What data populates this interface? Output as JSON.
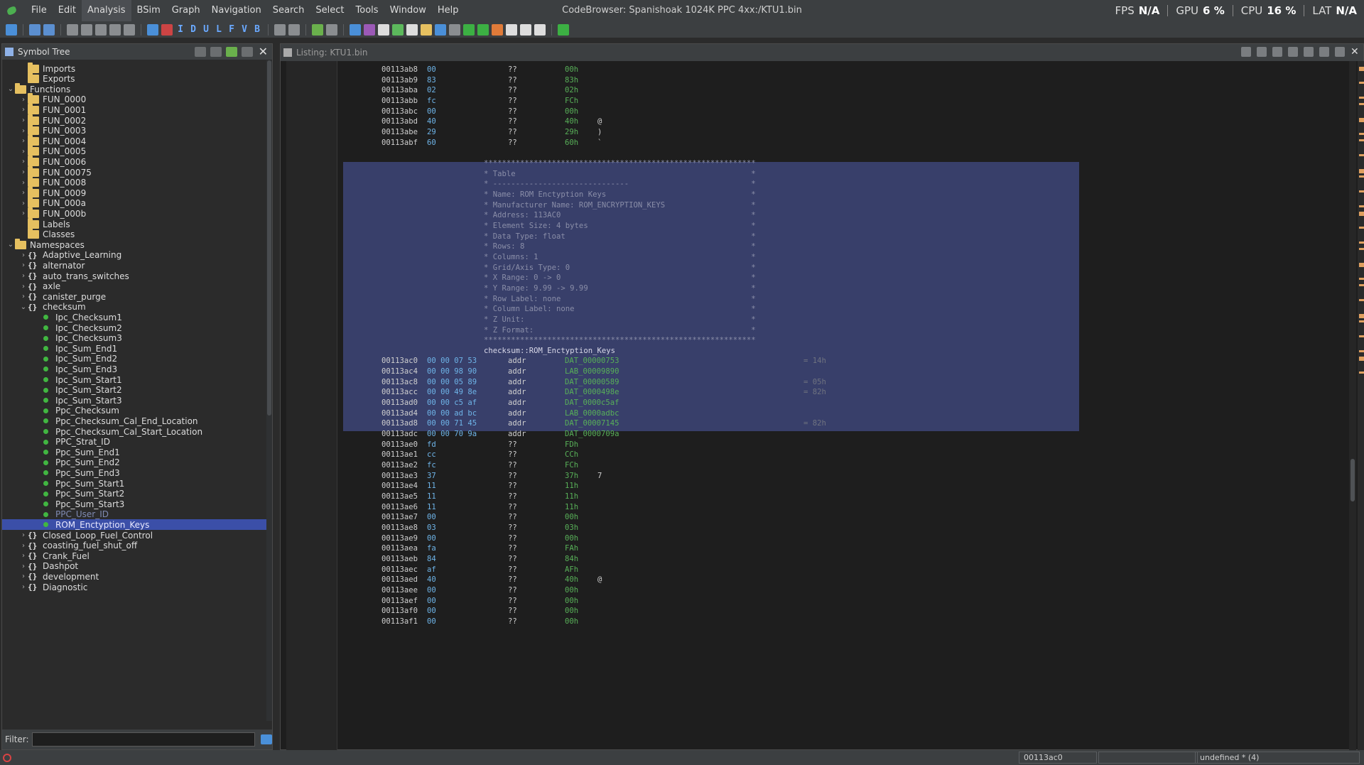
{
  "app": {
    "title": "CodeBrowser: Spanishoak 1024K PPC 4xx:/KTU1.bin",
    "menus": [
      "File",
      "Edit",
      "Analysis",
      "BSim",
      "Graph",
      "Navigation",
      "Search",
      "Select",
      "Tools",
      "Window",
      "Help"
    ],
    "active_menu": "Analysis"
  },
  "perf": {
    "fps_label": "FPS",
    "fps_value": "N/A",
    "gpu_label": "GPU",
    "gpu_value": "6 %",
    "cpu_label": "CPU",
    "cpu_value": "16 %",
    "lat_label": "LAT",
    "lat_value": "N/A"
  },
  "toolbar": {
    "letters": [
      "I",
      "D",
      "U",
      "L",
      "F",
      "V",
      "B"
    ]
  },
  "symbol_tree": {
    "title": "Symbol Tree",
    "filter_label": "Filter:",
    "filter_value": "",
    "rows": [
      {
        "level": 1,
        "kind": "folder",
        "chev": "",
        "label": "Imports"
      },
      {
        "level": 1,
        "kind": "folder",
        "chev": "",
        "label": "Exports"
      },
      {
        "level": 0,
        "kind": "folder",
        "chev": "v",
        "label": "Functions"
      },
      {
        "level": 1,
        "kind": "folder",
        "chev": ">",
        "label": "FUN_0000"
      },
      {
        "level": 1,
        "kind": "folder",
        "chev": ">",
        "label": "FUN_0001"
      },
      {
        "level": 1,
        "kind": "folder",
        "chev": ">",
        "label": "FUN_0002"
      },
      {
        "level": 1,
        "kind": "folder",
        "chev": ">",
        "label": "FUN_0003"
      },
      {
        "level": 1,
        "kind": "folder",
        "chev": ">",
        "label": "FUN_0004"
      },
      {
        "level": 1,
        "kind": "folder",
        "chev": ">",
        "label": "FUN_0005"
      },
      {
        "level": 1,
        "kind": "folder",
        "chev": ">",
        "label": "FUN_0006"
      },
      {
        "level": 1,
        "kind": "folder",
        "chev": ">",
        "label": "FUN_00075"
      },
      {
        "level": 1,
        "kind": "folder",
        "chev": ">",
        "label": "FUN_0008"
      },
      {
        "level": 1,
        "kind": "folder",
        "chev": ">",
        "label": "FUN_0009"
      },
      {
        "level": 1,
        "kind": "folder",
        "chev": ">",
        "label": "FUN_000a"
      },
      {
        "level": 1,
        "kind": "folder",
        "chev": ">",
        "label": "FUN_000b"
      },
      {
        "level": 1,
        "kind": "folder",
        "chev": "",
        "label": "Labels"
      },
      {
        "level": 1,
        "kind": "folder",
        "chev": "",
        "label": "Classes"
      },
      {
        "level": 0,
        "kind": "folder",
        "chev": "v",
        "label": "Namespaces"
      },
      {
        "level": 1,
        "kind": "ns",
        "chev": ">",
        "label": "Adaptive_Learning"
      },
      {
        "level": 1,
        "kind": "ns",
        "chev": ">",
        "label": "alternator"
      },
      {
        "level": 1,
        "kind": "ns",
        "chev": ">",
        "label": "auto_trans_switches"
      },
      {
        "level": 1,
        "kind": "ns",
        "chev": ">",
        "label": "axle"
      },
      {
        "level": 1,
        "kind": "ns",
        "chev": ">",
        "label": "canister_purge"
      },
      {
        "level": 1,
        "kind": "ns",
        "chev": "v",
        "label": "checksum"
      },
      {
        "level": 2,
        "kind": "dot",
        "chev": "",
        "label": "Ipc_Checksum1"
      },
      {
        "level": 2,
        "kind": "dot",
        "chev": "",
        "label": "Ipc_Checksum2"
      },
      {
        "level": 2,
        "kind": "dot",
        "chev": "",
        "label": "Ipc_Checksum3"
      },
      {
        "level": 2,
        "kind": "dot",
        "chev": "",
        "label": "Ipc_Sum_End1"
      },
      {
        "level": 2,
        "kind": "dot",
        "chev": "",
        "label": "Ipc_Sum_End2"
      },
      {
        "level": 2,
        "kind": "dot",
        "chev": "",
        "label": "Ipc_Sum_End3"
      },
      {
        "level": 2,
        "kind": "dot",
        "chev": "",
        "label": "Ipc_Sum_Start1"
      },
      {
        "level": 2,
        "kind": "dot",
        "chev": "",
        "label": "Ipc_Sum_Start2"
      },
      {
        "level": 2,
        "kind": "dot",
        "chev": "",
        "label": "Ipc_Sum_Start3"
      },
      {
        "level": 2,
        "kind": "dot",
        "chev": "",
        "label": "Ppc_Checksum"
      },
      {
        "level": 2,
        "kind": "dot",
        "chev": "",
        "label": "Ppc_Checksum_Cal_End_Location"
      },
      {
        "level": 2,
        "kind": "dot",
        "chev": "",
        "label": "Ppc_Checksum_Cal_Start_Location"
      },
      {
        "level": 2,
        "kind": "dot",
        "chev": "",
        "label": "PPC_Strat_ID"
      },
      {
        "level": 2,
        "kind": "dot",
        "chev": "",
        "label": "Ppc_Sum_End1"
      },
      {
        "level": 2,
        "kind": "dot",
        "chev": "",
        "label": "Ppc_Sum_End2"
      },
      {
        "level": 2,
        "kind": "dot",
        "chev": "",
        "label": "Ppc_Sum_End3"
      },
      {
        "level": 2,
        "kind": "dot",
        "chev": "",
        "label": "Ppc_Sum_Start1"
      },
      {
        "level": 2,
        "kind": "dot",
        "chev": "",
        "label": "Ppc_Sum_Start2"
      },
      {
        "level": 2,
        "kind": "dot",
        "chev": "",
        "label": "Ppc_Sum_Start3"
      },
      {
        "level": 2,
        "kind": "dot",
        "chev": "",
        "label": "PPC_User_ID",
        "dim": true
      },
      {
        "level": 2,
        "kind": "dot",
        "chev": "",
        "label": "ROM_Enctyption_Keys",
        "selected": true
      },
      {
        "level": 1,
        "kind": "ns",
        "chev": ">",
        "label": "Closed_Loop_Fuel_Control"
      },
      {
        "level": 1,
        "kind": "ns",
        "chev": ">",
        "label": "coasting_fuel_shut_off"
      },
      {
        "level": 1,
        "kind": "ns",
        "chev": ">",
        "label": "Crank_Fuel"
      },
      {
        "level": 1,
        "kind": "ns",
        "chev": ">",
        "label": "Dashpot"
      },
      {
        "level": 1,
        "kind": "ns",
        "chev": ">",
        "label": "development"
      },
      {
        "level": 1,
        "kind": "ns",
        "chev": ">",
        "label": "Diagnostic"
      }
    ]
  },
  "listing": {
    "title": "Listing:  KTU1.bin",
    "lines": [
      {
        "t": "data",
        "addr": "00113ab8",
        "bytes": "00",
        "mnem": "??",
        "oper": "00h",
        "ch": ""
      },
      {
        "t": "data",
        "addr": "00113ab9",
        "bytes": "83",
        "mnem": "??",
        "oper": "83h",
        "ch": ""
      },
      {
        "t": "data",
        "addr": "00113aba",
        "bytes": "02",
        "mnem": "??",
        "oper": "02h",
        "ch": ""
      },
      {
        "t": "data",
        "addr": "00113abb",
        "bytes": "fc",
        "mnem": "??",
        "oper": "FCh",
        "ch": ""
      },
      {
        "t": "data",
        "addr": "00113abc",
        "bytes": "00",
        "mnem": "??",
        "oper": "00h",
        "ch": ""
      },
      {
        "t": "data",
        "addr": "00113abd",
        "bytes": "40",
        "mnem": "??",
        "oper": "40h",
        "ch": "@"
      },
      {
        "t": "data",
        "addr": "00113abe",
        "bytes": "29",
        "mnem": "??",
        "oper": "29h",
        "ch": ")"
      },
      {
        "t": "data",
        "addr": "00113abf",
        "bytes": "60",
        "mnem": "??",
        "oper": "60h",
        "ch": "`"
      },
      {
        "t": "blank"
      },
      {
        "t": "plate",
        "text": "************************************************************"
      },
      {
        "t": "plate",
        "text": "* Table                                                    *"
      },
      {
        "t": "plate",
        "text": "* ------------------------------                           *"
      },
      {
        "t": "plate",
        "text": "* Name: ROM Enctyption Keys                                *"
      },
      {
        "t": "plate",
        "text": "* Manufacturer Name: ROM_ENCRYPTION_KEYS                   *"
      },
      {
        "t": "plate",
        "text": "* Address: 113AC0                                          *"
      },
      {
        "t": "plate",
        "text": "* Element Size: 4 bytes                                    *"
      },
      {
        "t": "plate",
        "text": "* Data Type: float                                         *"
      },
      {
        "t": "plate",
        "text": "* Rows: 8                                                  *"
      },
      {
        "t": "plate",
        "text": "* Columns: 1                                               *"
      },
      {
        "t": "plate",
        "text": "* Grid/Axis Type: 0                                        *"
      },
      {
        "t": "plate",
        "text": "* X Range: 0 -> 0                                          *"
      },
      {
        "t": "plate",
        "text": "* Y Range: 9.99 -> 9.99                                    *"
      },
      {
        "t": "plate",
        "text": "* Row Label: none                                          *"
      },
      {
        "t": "plate",
        "text": "* Column Label: none                                       *"
      },
      {
        "t": "plate",
        "text": "* Z Unit:                                                  *"
      },
      {
        "t": "plate",
        "text": "* Z Format:                                                *"
      },
      {
        "t": "plate",
        "text": "************************************************************"
      },
      {
        "t": "label",
        "text": "checksum::ROM_Enctyption_Keys"
      },
      {
        "t": "data",
        "addr": "00113ac0",
        "bytes": "00 00 07 53",
        "mnem": "addr",
        "oper": "DAT_00000753",
        "ch": "",
        "cmt": "= 14h"
      },
      {
        "t": "data",
        "addr": "00113ac4",
        "bytes": "00 00 98 90",
        "mnem": "addr",
        "oper": "LAB_00009890",
        "ch": ""
      },
      {
        "t": "data",
        "addr": "00113ac8",
        "bytes": "00 00 05 89",
        "mnem": "addr",
        "oper": "DAT_00000589",
        "ch": "",
        "cmt": "= 05h"
      },
      {
        "t": "data",
        "addr": "00113acc",
        "bytes": "00 00 49 8e",
        "mnem": "addr",
        "oper": "DAT_0000498e",
        "ch": "",
        "cmt": "= 82h"
      },
      {
        "t": "data",
        "addr": "00113ad0",
        "bytes": "00 00 c5 af",
        "mnem": "addr",
        "oper": "DAT_0000c5af",
        "ch": ""
      },
      {
        "t": "data",
        "addr": "00113ad4",
        "bytes": "00 00 ad bc",
        "mnem": "addr",
        "oper": "LAB_0000adbc",
        "ch": ""
      },
      {
        "t": "data",
        "addr": "00113ad8",
        "bytes": "00 00 71 45",
        "mnem": "addr",
        "oper": "DAT_00007145",
        "ch": "",
        "cmt": "= 82h"
      },
      {
        "t": "data",
        "addr": "00113adc",
        "bytes": "00 00 70 9a",
        "mnem": "addr",
        "oper": "DAT_0000709a",
        "ch": ""
      },
      {
        "t": "data",
        "addr": "00113ae0",
        "bytes": "fd",
        "mnem": "??",
        "oper": "FDh",
        "ch": ""
      },
      {
        "t": "data",
        "addr": "00113ae1",
        "bytes": "cc",
        "mnem": "??",
        "oper": "CCh",
        "ch": ""
      },
      {
        "t": "data",
        "addr": "00113ae2",
        "bytes": "fc",
        "mnem": "??",
        "oper": "FCh",
        "ch": ""
      },
      {
        "t": "data",
        "addr": "00113ae3",
        "bytes": "37",
        "mnem": "??",
        "oper": "37h",
        "ch": "7"
      },
      {
        "t": "data",
        "addr": "00113ae4",
        "bytes": "11",
        "mnem": "??",
        "oper": "11h",
        "ch": ""
      },
      {
        "t": "data",
        "addr": "00113ae5",
        "bytes": "11",
        "mnem": "??",
        "oper": "11h",
        "ch": ""
      },
      {
        "t": "data",
        "addr": "00113ae6",
        "bytes": "11",
        "mnem": "??",
        "oper": "11h",
        "ch": ""
      },
      {
        "t": "data",
        "addr": "00113ae7",
        "bytes": "00",
        "mnem": "??",
        "oper": "00h",
        "ch": ""
      },
      {
        "t": "data",
        "addr": "00113ae8",
        "bytes": "03",
        "mnem": "??",
        "oper": "03h",
        "ch": ""
      },
      {
        "t": "data",
        "addr": "00113ae9",
        "bytes": "00",
        "mnem": "??",
        "oper": "00h",
        "ch": ""
      },
      {
        "t": "data",
        "addr": "00113aea",
        "bytes": "fa",
        "mnem": "??",
        "oper": "FAh",
        "ch": ""
      },
      {
        "t": "data",
        "addr": "00113aeb",
        "bytes": "84",
        "mnem": "??",
        "oper": "84h",
        "ch": ""
      },
      {
        "t": "data",
        "addr": "00113aec",
        "bytes": "af",
        "mnem": "??",
        "oper": "AFh",
        "ch": ""
      },
      {
        "t": "data",
        "addr": "00113aed",
        "bytes": "40",
        "mnem": "??",
        "oper": "40h",
        "ch": "@"
      },
      {
        "t": "data",
        "addr": "00113aee",
        "bytes": "00",
        "mnem": "??",
        "oper": "00h",
        "ch": ""
      },
      {
        "t": "data",
        "addr": "00113aef",
        "bytes": "00",
        "mnem": "??",
        "oper": "00h",
        "ch": ""
      },
      {
        "t": "data",
        "addr": "00113af0",
        "bytes": "00",
        "mnem": "??",
        "oper": "00h",
        "ch": ""
      },
      {
        "t": "data",
        "addr": "00113af1",
        "bytes": "00",
        "mnem": "??",
        "oper": "00h",
        "ch": ""
      }
    ]
  },
  "status": {
    "address": "00113ac0",
    "type": "undefined * (4)"
  }
}
